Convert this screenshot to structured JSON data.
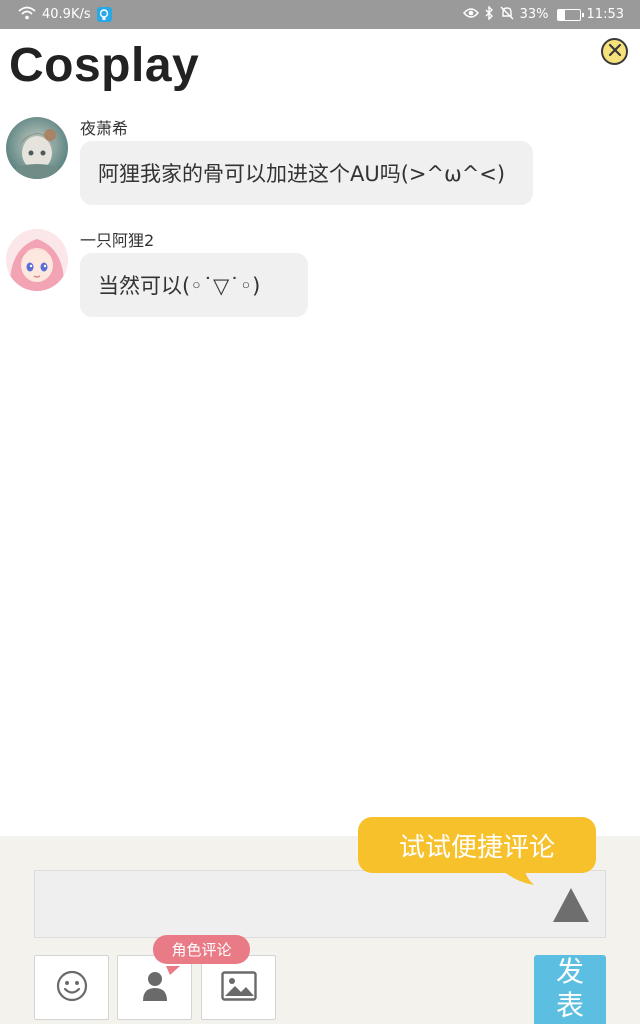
{
  "status_bar": {
    "speed": "40.9K/s",
    "battery": "33%",
    "time": "11:53",
    "battery_fraction": 0.33
  },
  "header": {
    "title": "Cosplay"
  },
  "messages": [
    {
      "username": "夜萧希",
      "text": "阿狸我家的骨可以加进这个AU吗(>^ω^<)"
    },
    {
      "username": "一只阿狸2",
      "text": "当然可以(◦˙▽˙◦)"
    }
  ],
  "composer": {
    "quick_tip": "试试便捷评论",
    "input_value": "",
    "role_tag": "角色评论",
    "send_label": "发表"
  },
  "colors": {
    "accent_yellow": "#f6c12b",
    "role_pink": "#e87b86",
    "send_blue": "#5cbfe1"
  },
  "icons": {
    "wifi": "wifi-icon",
    "app": "lightbulb-icon",
    "eye": "eye-icon",
    "bluetooth": "bluetooth-icon",
    "mute": "bell-off-icon",
    "close": "close-icon",
    "expand": "triangle-up-icon",
    "emoji": "smiley-icon",
    "role": "person-icon",
    "image": "image-icon"
  }
}
